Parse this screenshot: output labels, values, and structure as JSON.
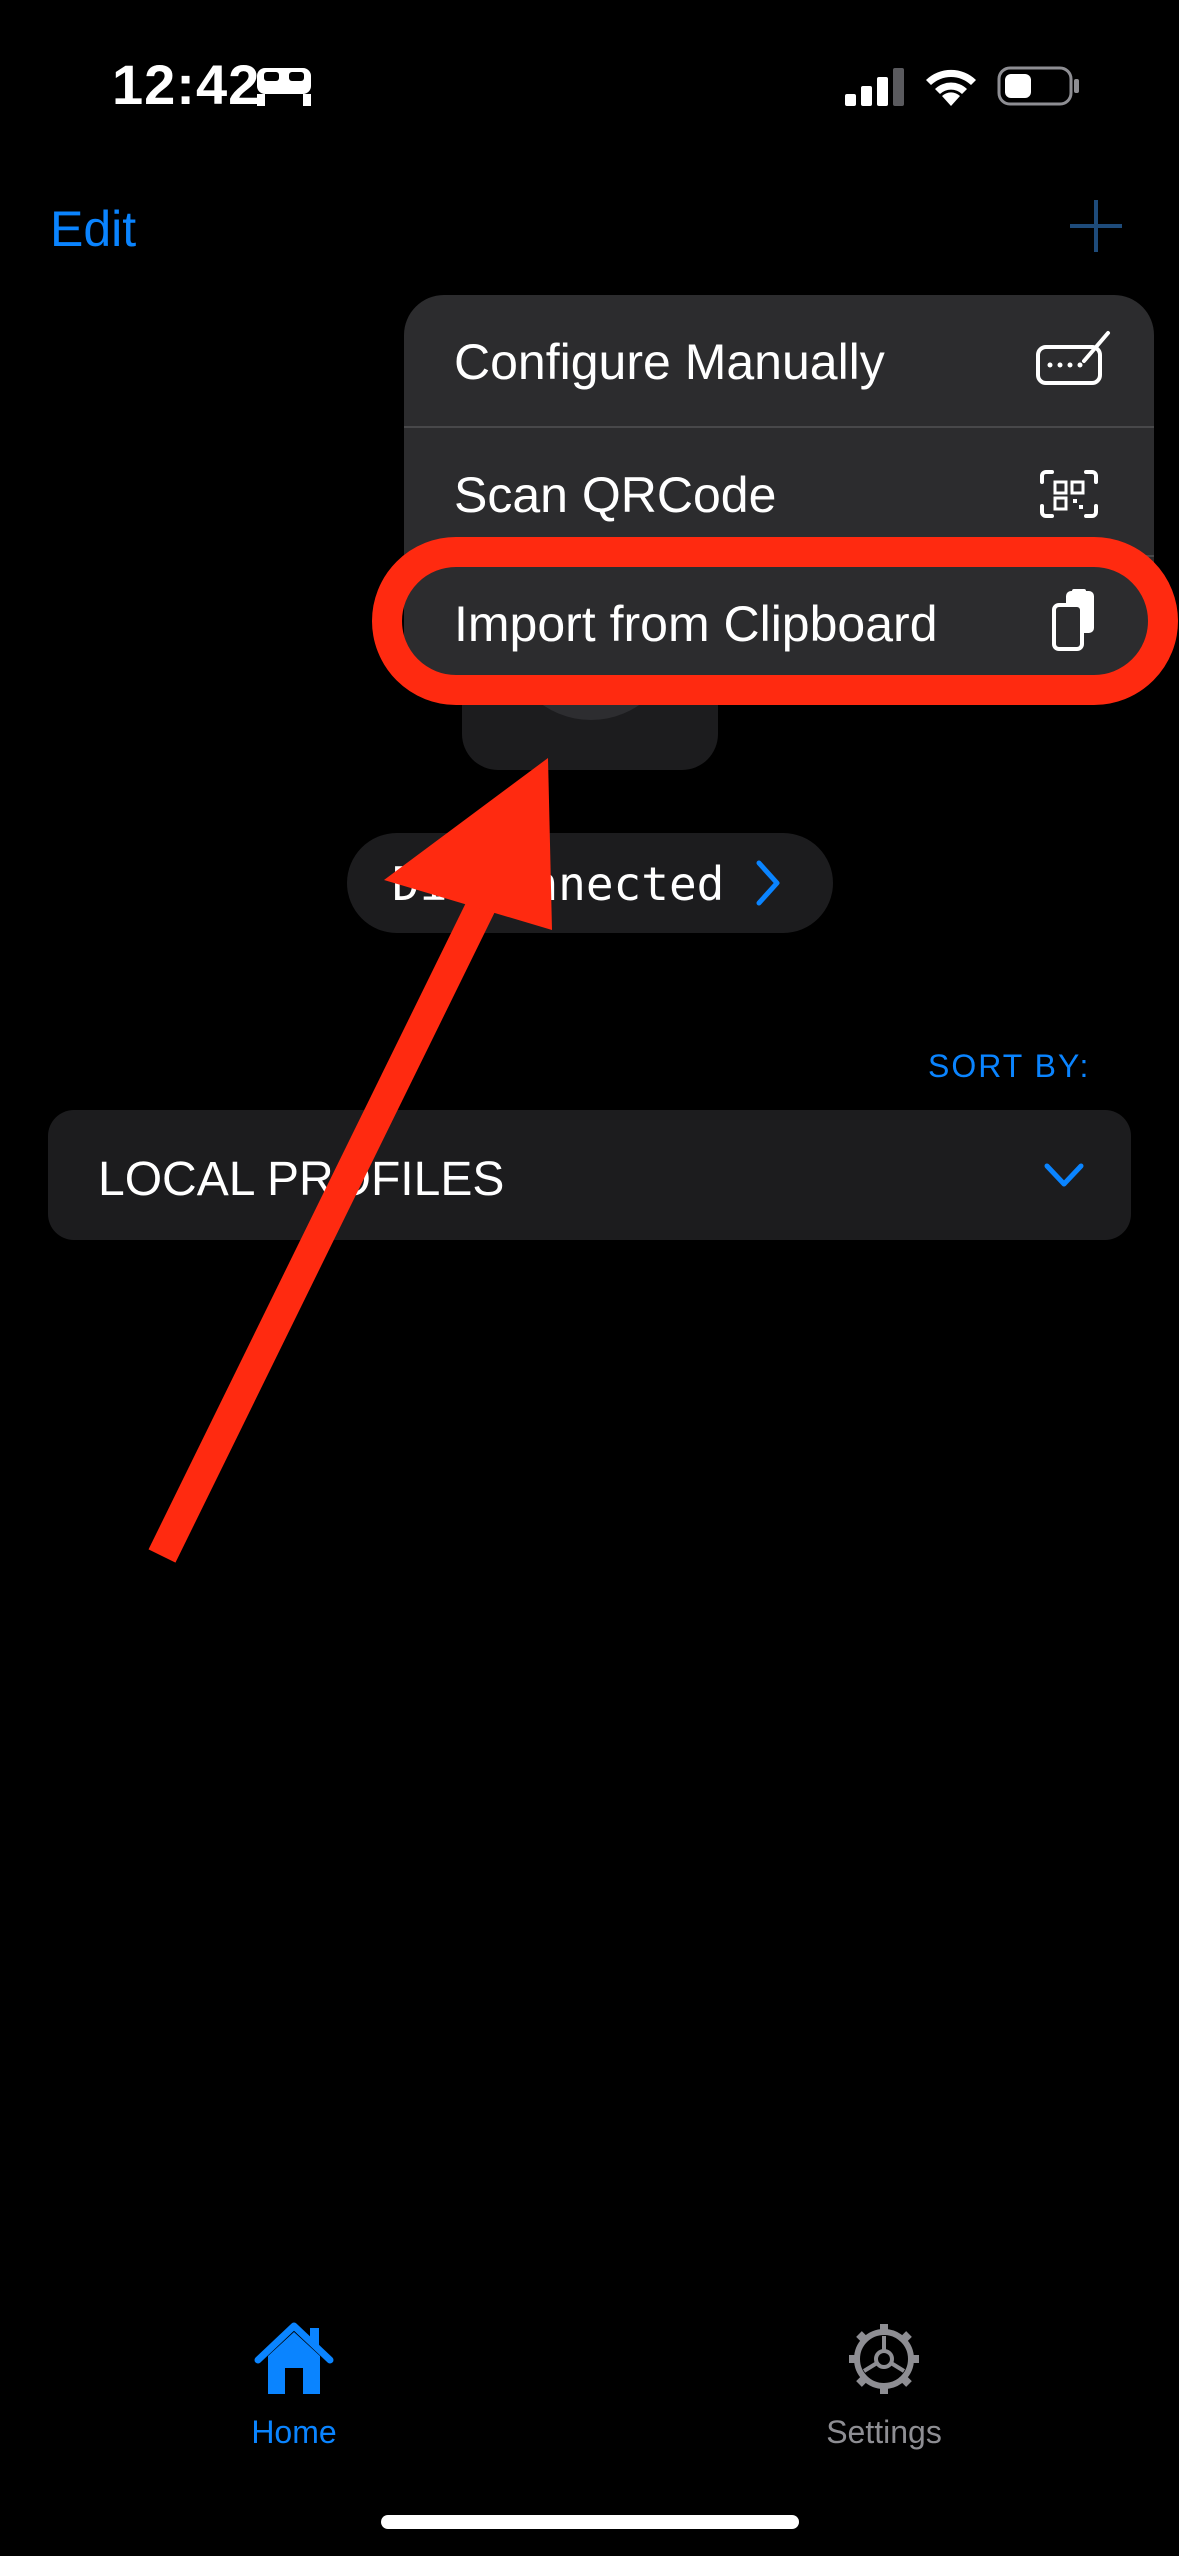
{
  "status_bar": {
    "time": "12:42",
    "focus_icon": "bed-icon",
    "signal_icon": "cellular-signal-icon",
    "wifi_icon": "wifi-icon",
    "battery_icon": "battery-icon"
  },
  "nav": {
    "edit_label": "Edit",
    "add_icon": "plus-icon"
  },
  "menu": {
    "items": [
      {
        "label": "Configure Manually",
        "icon": "keyboard-edit-icon"
      },
      {
        "label": "Scan QRCode",
        "icon": "qrcode-scan-icon"
      },
      {
        "label": "Import from Clipboard",
        "icon": "clipboard-icon"
      }
    ]
  },
  "connection": {
    "status": "Disconnected",
    "chevron_icon": "chevron-right-icon"
  },
  "sort": {
    "label": "SORT BY:"
  },
  "profiles": {
    "section_label": "LOCAL PROFILES",
    "chevron_icon": "chevron-down-icon"
  },
  "annotation": {
    "color": "#ff2a10",
    "highlight_target": "Import from Clipboard"
  },
  "tab_bar": {
    "tabs": [
      {
        "label": "Home",
        "icon": "house-icon",
        "selected": true
      },
      {
        "label": "Settings",
        "icon": "gear-icon",
        "selected": false
      }
    ]
  },
  "colors": {
    "accent": "#0a84ff",
    "background": "#000000",
    "surface": "#1c1c1e",
    "menu_surface": "#2c2c2e",
    "inactive": "#8e8e93"
  }
}
